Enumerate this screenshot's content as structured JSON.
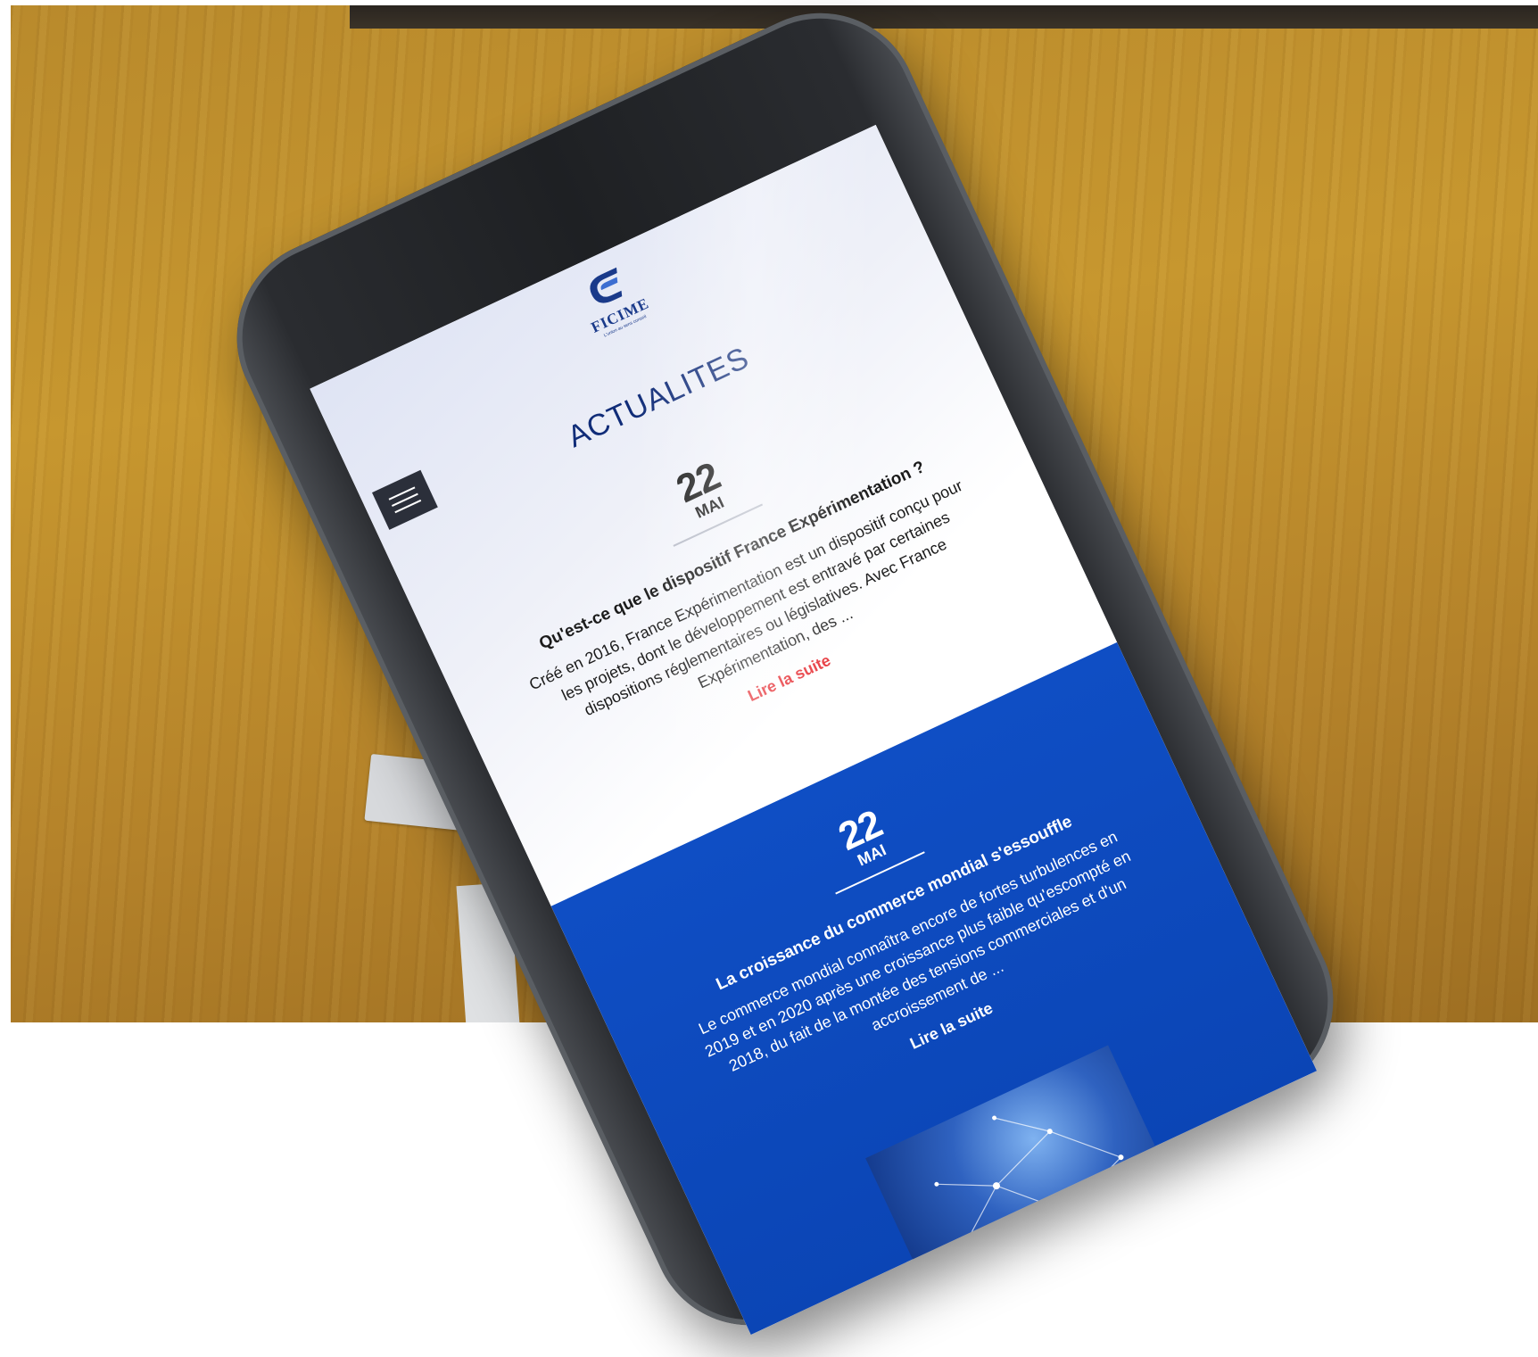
{
  "brand": {
    "name": "FICIME",
    "tagline": "L'union au sens conseil"
  },
  "menu_icon": "hamburger-menu-icon",
  "page_title": "ACTUALITES",
  "news": [
    {
      "day": "22",
      "month": "MAI",
      "title": "Qu'est-ce que le dispositif France Expérimentation ?",
      "excerpt": "Créé en 2016, France Expérimentation est un dispositif conçu pour les projets, dont le développement est entravé par certaines dispositions réglementaires ou législatives. Avec France Expérimentation, des ...",
      "link": "Lire la suite"
    },
    {
      "day": "22",
      "month": "MAI",
      "title": "La croissance du commerce mondial s'essouffle",
      "excerpt": "Le commerce mondial connaîtra encore de fortes turbulences en 2019 et en 2020 après une croissance plus faible qu'escompté en 2018, du fait de la montée des tensions commerciales et d'un accroissement de ...",
      "link": "Lire la suite"
    }
  ],
  "colors": {
    "brand_blue": "#102c78",
    "section_blue": "#0f4ec4",
    "link_red": "#e5242a"
  }
}
